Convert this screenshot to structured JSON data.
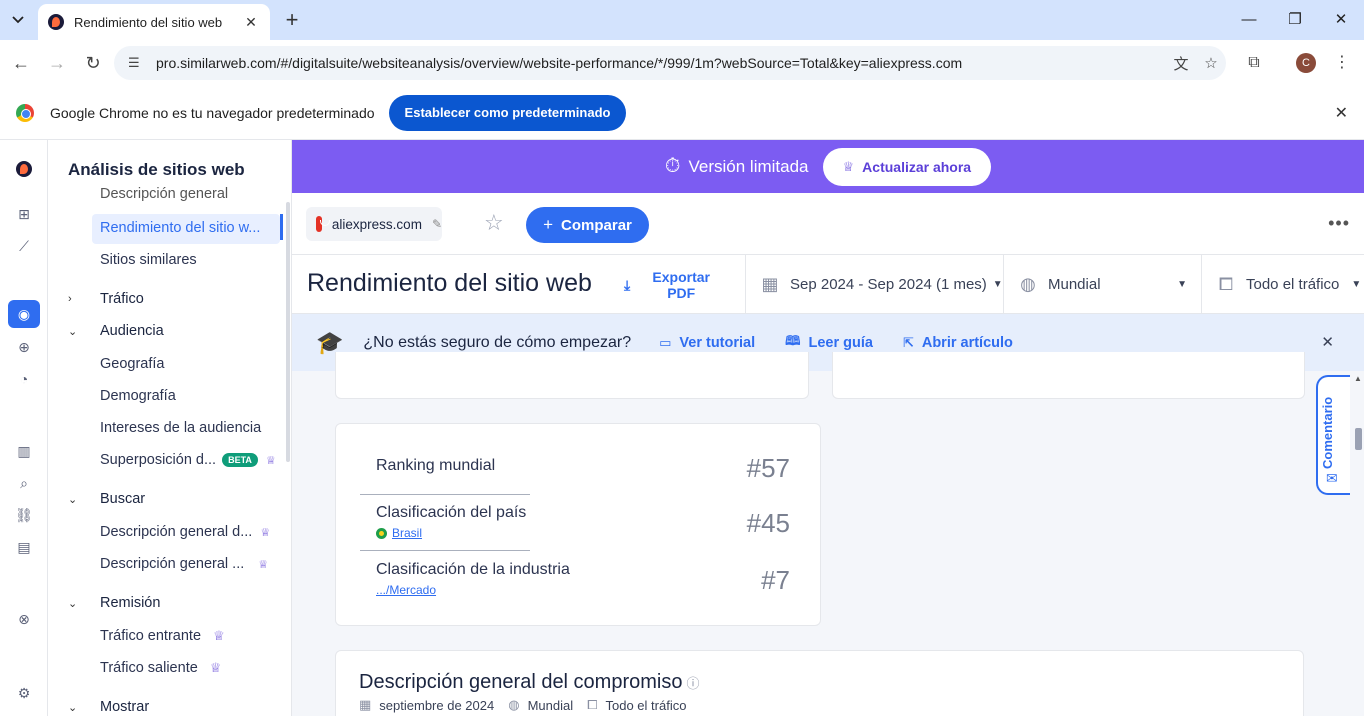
{
  "browser": {
    "tab_title": "Rendimiento del sitio web",
    "url": "pro.similarweb.com/#/digitalsuite/websiteanalysis/overview/website-performance/*/999/1m?webSource=Total&key=aliexpress.com",
    "profile_initial": "C",
    "infobar_message": "Google Chrome no es tu navegador predeterminado",
    "infobar_button": "Establecer como predeterminado"
  },
  "sidebar": {
    "title": "Análisis de sitios web",
    "cut_item": "Descripción general",
    "items": {
      "performance": "Rendimiento del sitio w...",
      "similar": "Sitios similares",
      "traffic": "Tráfico",
      "audience": "Audiencia",
      "geography": "Geografía",
      "demography": "Demografía",
      "interests": "Intereses de la audiencia",
      "overlap": "Superposición d...",
      "search": "Buscar",
      "search_overview_1": "Descripción general d...",
      "search_overview_2": "Descripción general ...",
      "referral": "Remisión",
      "incoming": "Tráfico entrante",
      "outgoing": "Tráfico saliente",
      "display": "Mostrar"
    },
    "beta_label": "BETA"
  },
  "promo": {
    "text": "Versión limitada",
    "upgrade": "Actualizar ahora"
  },
  "site": {
    "domain": "aliexpress.com",
    "compare": "Comparar"
  },
  "titlebar": {
    "title": "Rendimiento del sitio web",
    "export": "Exportar PDF",
    "date_range": "Sep 2024 - Sep 2024 (1 mes)",
    "region": "Mundial",
    "traffic": "Todo el tráfico"
  },
  "tip": {
    "question": "¿No estás seguro de cómo empezar?",
    "tutorial": "Ver tutorial",
    "guide": "Leer guía",
    "article": "Abrir artículo"
  },
  "ranking": {
    "global_label": "Ranking mundial",
    "global_value": "#57",
    "country_label": "Clasificación del país",
    "country_name": "Brasil",
    "country_value": "#45",
    "industry_label": "Clasificación de la industria",
    "industry_name": ".../Mercado",
    "industry_value": "#7"
  },
  "engagement": {
    "title": "Descripción general del compromiso",
    "date": "septiembre de 2024",
    "region": "Mundial",
    "traffic": "Todo el tráfico"
  },
  "feedback": "Comentario",
  "colors": {
    "accent": "#2f6df0",
    "promo": "#7c5cf2",
    "chrome_tabstrip": "#d3e3fd"
  }
}
